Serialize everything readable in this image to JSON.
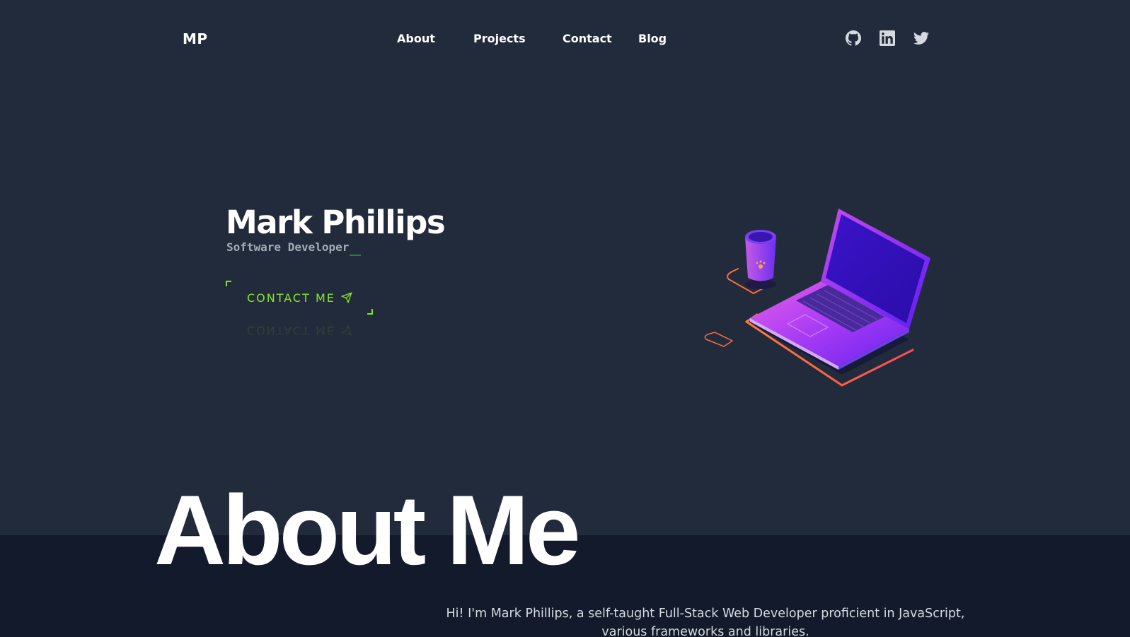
{
  "nav": {
    "logo": "MP",
    "links": [
      "About",
      "Projects",
      "Contact",
      "Blog"
    ],
    "social": [
      "github-icon",
      "linkedin-icon",
      "twitter-icon"
    ]
  },
  "hero": {
    "name": "Mark Phillips",
    "role": "Software Developer",
    "cta_label": "CONTACT ME",
    "cta_icon": "send-icon",
    "illustration": "isometric laptop and cup"
  },
  "about": {
    "heading": "About Me",
    "intro": "Hi! I'm Mark Phillips, a self-taught Full-Stack Web Developer proficient in JavaScript, various frameworks and libraries."
  },
  "colors": {
    "background": "#222b3b",
    "about_background": "#121a2b",
    "accent": "#84e623",
    "text": "#ffffff",
    "muted": "#a3abb8"
  }
}
